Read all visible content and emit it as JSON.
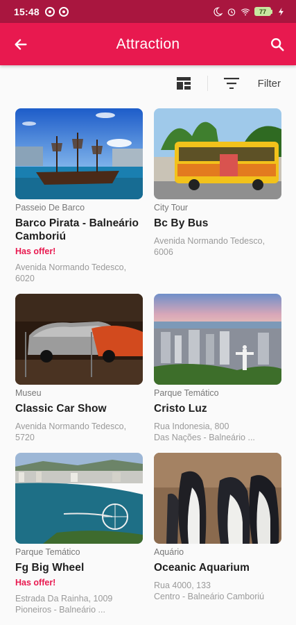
{
  "status_bar": {
    "time": "15:48",
    "battery": "77"
  },
  "app_bar": {
    "title": "Attraction"
  },
  "toolbar": {
    "filter_label": "Filter"
  },
  "colors": {
    "primary": "#e8194f",
    "status_bar": "#a9163f",
    "offer": "#e8194f"
  },
  "items": [
    {
      "category": "Passeio De Barco",
      "title": "Barco Pirata - Balneário Camboriú",
      "offer": "Has offer!",
      "address_lines": [
        "Avenida Normando Tedesco,",
        "6020"
      ]
    },
    {
      "category": "City Tour",
      "title": "Bc By Bus",
      "offer": "",
      "address_lines": [
        "Avenida Normando Tedesco,",
        "6006"
      ]
    },
    {
      "category": "Museu",
      "title": "Classic Car Show",
      "offer": "",
      "address_lines": [
        "Avenida Normando Tedesco,",
        "5720"
      ]
    },
    {
      "category": "Parque Temático",
      "title": "Cristo Luz",
      "offer": "",
      "address_lines": [
        "Rua Indonesia, 800",
        "Das Nações - Balneário ..."
      ]
    },
    {
      "category": "Parque Temático",
      "title": "Fg Big Wheel",
      "offer": "Has offer!",
      "address_lines": [
        "Estrada Da Rainha, 1009",
        "Pioneiros - Balneário ..."
      ]
    },
    {
      "category": "Aquário",
      "title": "Oceanic Aquarium",
      "offer": "",
      "address_lines": [
        "Rua 4000, 133",
        "Centro - Balneário Camboriú"
      ]
    }
  ]
}
